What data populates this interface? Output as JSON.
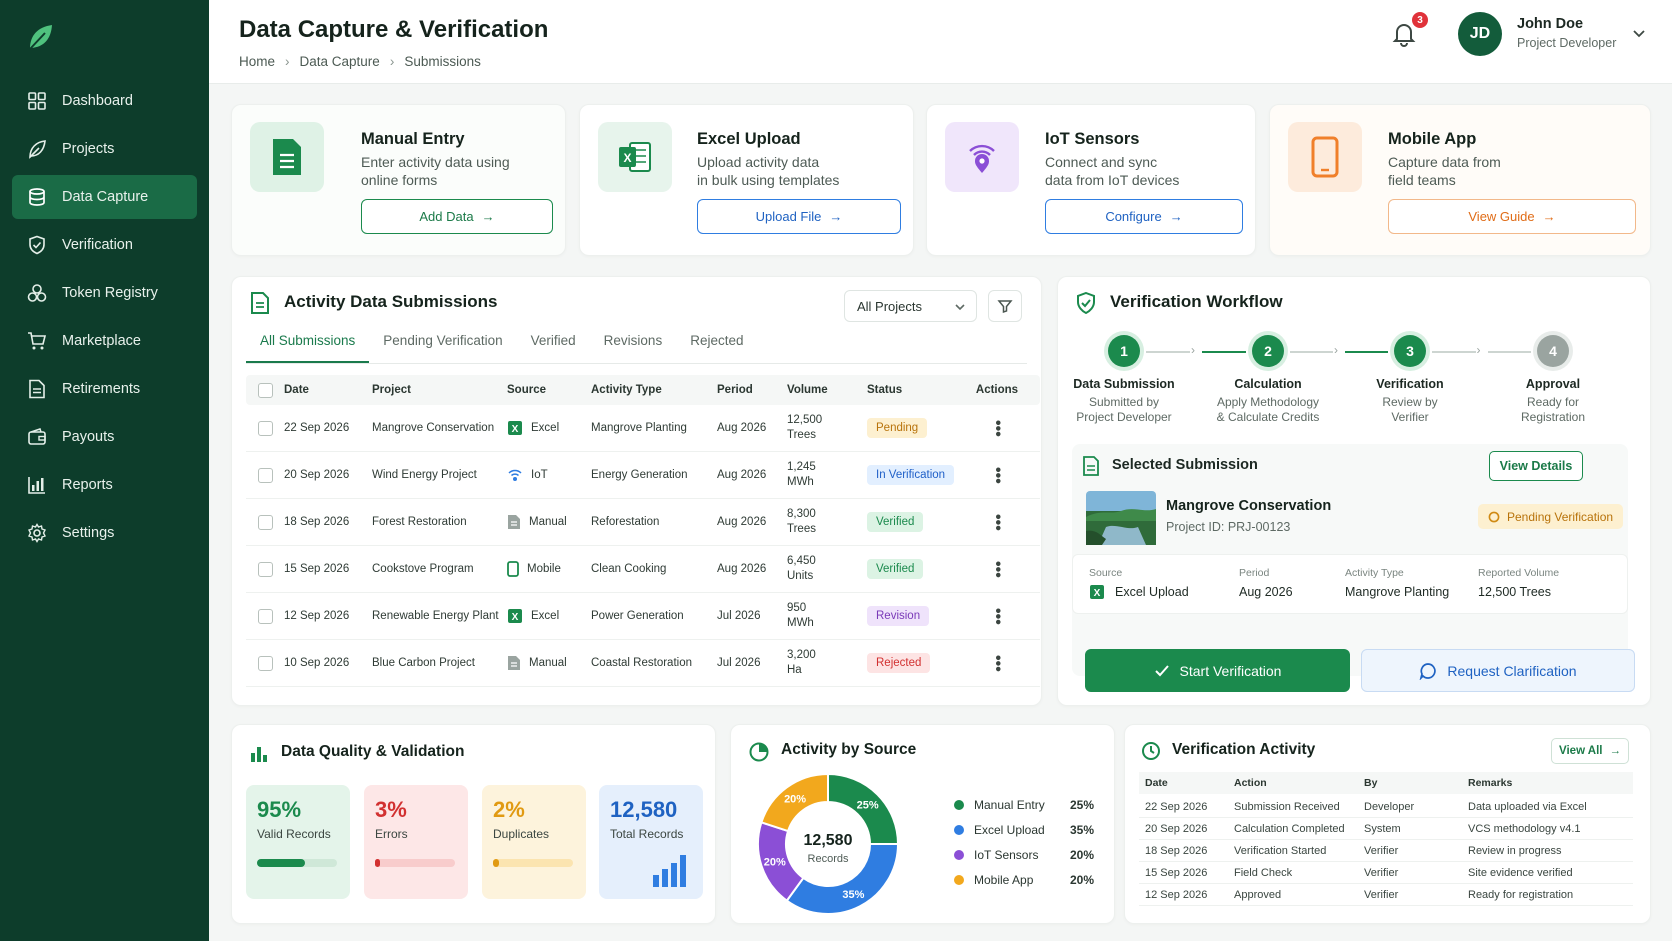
{
  "sidebar": {
    "items": [
      {
        "label": "Dashboard",
        "icon": "grid-icon"
      },
      {
        "label": "Projects",
        "icon": "leaf-icon"
      },
      {
        "label": "Data Capture",
        "icon": "database-icon"
      },
      {
        "label": "Verification",
        "icon": "shield-check-icon"
      },
      {
        "label": "Token Registry",
        "icon": "token-icon"
      },
      {
        "label": "Marketplace",
        "icon": "cart-icon"
      },
      {
        "label": "Retirements",
        "icon": "document-icon"
      },
      {
        "label": "Payouts",
        "icon": "wallet-icon"
      },
      {
        "label": "Reports",
        "icon": "bar-chart-icon"
      },
      {
        "label": "Settings",
        "icon": "gear-icon"
      }
    ],
    "active_index": 2
  },
  "header": {
    "title": "Data Capture & Verification",
    "breadcrumb": [
      "Home",
      "Data Capture",
      "Submissions"
    ],
    "notification_count": "3",
    "user": {
      "initials": "JD",
      "name": "John Doe",
      "role": "Project Developer"
    }
  },
  "capture_cards": [
    {
      "title": "Manual Entry",
      "desc_line1": "Enter activity data using",
      "desc_line2": "online forms",
      "button": "Add Data",
      "icon": "form-icon"
    },
    {
      "title": "Excel Upload",
      "desc_line1": "Upload activity data",
      "desc_line2": "in bulk using templates",
      "button": "Upload File",
      "icon": "excel-icon"
    },
    {
      "title": "IoT Sensors",
      "desc_line1": "Connect and sync",
      "desc_line2": "data from IoT devices",
      "button": "Configure",
      "icon": "iot-icon"
    },
    {
      "title": "Mobile App",
      "desc_line1": "Capture data from",
      "desc_line2": "field teams",
      "button": "View Guide",
      "icon": "mobile-icon"
    }
  ],
  "submissions": {
    "title": "Activity Data Submissions",
    "project_filter": "All Projects",
    "tabs": [
      "All Submissions",
      "Pending Verification",
      "Verified",
      "Revisions",
      "Rejected"
    ],
    "columns": [
      "Date",
      "Project",
      "Source",
      "Activity Type",
      "Period",
      "Volume",
      "Status",
      "Actions"
    ],
    "rows": [
      {
        "date": "22 Sep 2026",
        "project": "Mangrove Conservation",
        "source": "Excel",
        "src_icon": "excel",
        "activity": "Mangrove Planting",
        "period": "Aug 2026",
        "vol1": "12,500",
        "vol2": "Trees",
        "status": "Pending",
        "cls": "b-pending"
      },
      {
        "date": "20 Sep 2026",
        "project": "Wind Energy Project",
        "source": "IoT",
        "src_icon": "iot",
        "activity": "Energy Generation",
        "period": "Aug 2026",
        "vol1": "1,245",
        "vol2": "MWh",
        "status": "In Verification",
        "cls": "b-inver"
      },
      {
        "date": "18 Sep 2026",
        "project": "Forest Restoration",
        "source": "Manual",
        "src_icon": "manual",
        "activity": "Reforestation",
        "period": "Aug 2026",
        "vol1": "8,300",
        "vol2": "Trees",
        "status": "Verified",
        "cls": "b-verified"
      },
      {
        "date": "15 Sep 2026",
        "project": "Cookstove Program",
        "source": "Mobile",
        "src_icon": "mobile",
        "activity": "Clean Cooking",
        "period": "Aug 2026",
        "vol1": "6,450",
        "vol2": "Units",
        "status": "Verified",
        "cls": "b-verified"
      },
      {
        "date": "12 Sep 2026",
        "project": "Renewable Energy Plant",
        "source": "Excel",
        "src_icon": "excel",
        "activity": "Power Generation",
        "period": "Jul 2026",
        "vol1": "950",
        "vol2": "MWh",
        "status": "Revision",
        "cls": "b-revision"
      },
      {
        "date": "10 Sep 2026",
        "project": "Blue Carbon Project",
        "source": "Manual",
        "src_icon": "manual",
        "activity": "Coastal Restoration",
        "period": "Jul 2026",
        "vol1": "3,200",
        "vol2": "Ha",
        "status": "Rejected",
        "cls": "b-rejected"
      }
    ]
  },
  "workflow": {
    "title": "Verification Workflow",
    "steps": [
      {
        "num": "1",
        "title": "Data Submission",
        "sub1": "Submitted by",
        "sub2": "Project Developer",
        "done": true
      },
      {
        "num": "2",
        "title": "Calculation",
        "sub1": "Apply Methodology",
        "sub2": "& Calculate Credits",
        "done": true
      },
      {
        "num": "3",
        "title": "Verification",
        "sub1": "Review by",
        "sub2": "Verifier",
        "done": true
      },
      {
        "num": "4",
        "title": "Approval",
        "sub1": "Ready for",
        "sub2": "Registration",
        "done": false
      }
    ],
    "selected": {
      "heading": "Selected Submission",
      "view_details": "View Details",
      "project": "Mangrove Conservation",
      "project_id": "Project ID: PRJ-00123",
      "status": "Pending Verification",
      "meta": [
        {
          "label": "Source",
          "value": "Excel Upload"
        },
        {
          "label": "Period",
          "value": "Aug 2026"
        },
        {
          "label": "Activity Type",
          "value": "Mangrove Planting"
        },
        {
          "label": "Reported Volume",
          "value": "12,500 Trees"
        }
      ],
      "start_btn": "Start Verification",
      "clarify_btn": "Request Clarification"
    }
  },
  "quality": {
    "title": "Data Quality & Validation",
    "tiles": [
      {
        "value": "95%",
        "label": "Valid Records",
        "fill": 0.6
      },
      {
        "value": "3%",
        "label": "Errors",
        "fill": 0.06
      },
      {
        "value": "2%",
        "label": "Duplicates",
        "fill": 0.07
      },
      {
        "value": "12,580",
        "label": "Total Records"
      }
    ]
  },
  "source_chart": {
    "title": "Activity by Source",
    "center_value": "12,580",
    "center_label": "Records"
  },
  "chart_data": {
    "type": "pie",
    "title": "Activity by Source",
    "categories": [
      "Manual Entry",
      "Excel Upload",
      "IoT Sensors",
      "Mobile App"
    ],
    "values": [
      25,
      35,
      20,
      20
    ],
    "labels": [
      "25%",
      "35%",
      "20%",
      "20%"
    ],
    "colors": [
      "#1b8a4d",
      "#2f7de1",
      "#8b4fd6",
      "#f2a81d"
    ],
    "legend_placement": "right"
  },
  "activity": {
    "title": "Verification Activity",
    "view_all": "View All",
    "columns": [
      "Date",
      "Action",
      "By",
      "Remarks"
    ],
    "rows": [
      [
        "22 Sep 2026",
        "Submission Received",
        "Developer",
        "Data uploaded via Excel"
      ],
      [
        "20 Sep 2026",
        "Calculation Completed",
        "System",
        "VCS methodology v4.1"
      ],
      [
        "18 Sep 2026",
        "Verification Started",
        "Verifier",
        "Review in progress"
      ],
      [
        "15 Sep 2026",
        "Field Check",
        "Verifier",
        "Site evidence verified"
      ],
      [
        "12 Sep 2026",
        "Approved",
        "Verifier",
        "Ready for registration"
      ]
    ]
  }
}
